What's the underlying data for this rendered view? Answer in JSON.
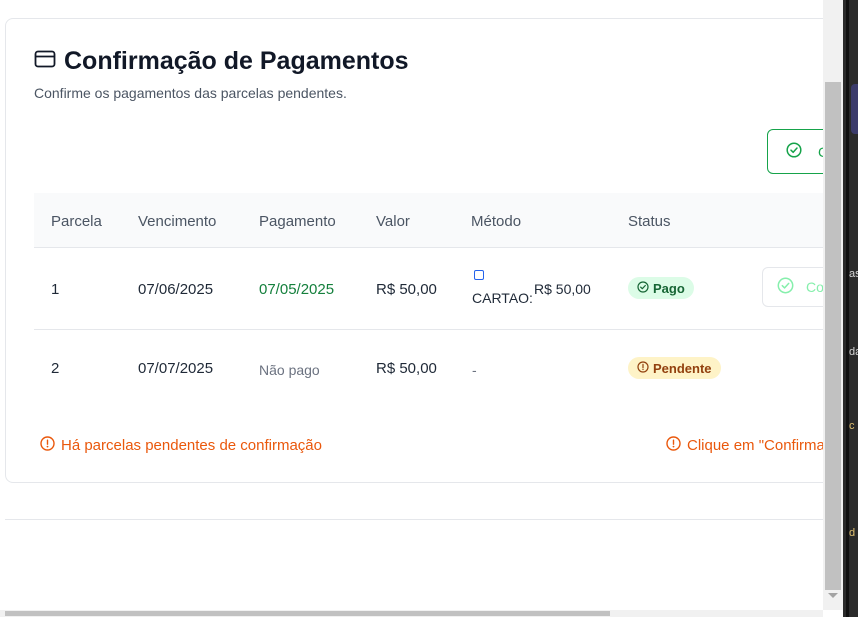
{
  "card": {
    "title": "Confirmação de Pagamentos",
    "subtitle": "Confirme os pagamentos das parcelas pendentes.",
    "confirm_all_label": "C"
  },
  "table": {
    "headers": [
      "Parcela",
      "Vencimento",
      "Pagamento",
      "Valor",
      "Método",
      "Status"
    ],
    "rows": [
      {
        "parcela": "1",
        "vencimento": "07/06/2025",
        "pagamento": "07/05/2025",
        "valor": "R$ 50,00",
        "metodo_label": "CARTAO:",
        "metodo_valor": "R$ 50,00",
        "status": "Pago",
        "action_label": "Co"
      },
      {
        "parcela": "2",
        "vencimento": "07/07/2025",
        "pagamento": "Não pago",
        "valor": "R$ 50,00",
        "metodo_label": "-",
        "status": "Pendente"
      }
    ]
  },
  "warnings": {
    "left": "Há parcelas pendentes de confirmação",
    "right": "Clique em \"Confirma"
  },
  "edge_fragments": [
    "as",
    "da",
    "c",
    "d"
  ],
  "colors": {
    "success": "#16a34a",
    "warning": "#ea580c",
    "pending_badge_bg": "#fef3c7",
    "paid_badge_bg": "#dcfce7"
  },
  "icons": [
    "card-icon",
    "check-circle-icon",
    "alert-circle-icon",
    "square-icon"
  ]
}
